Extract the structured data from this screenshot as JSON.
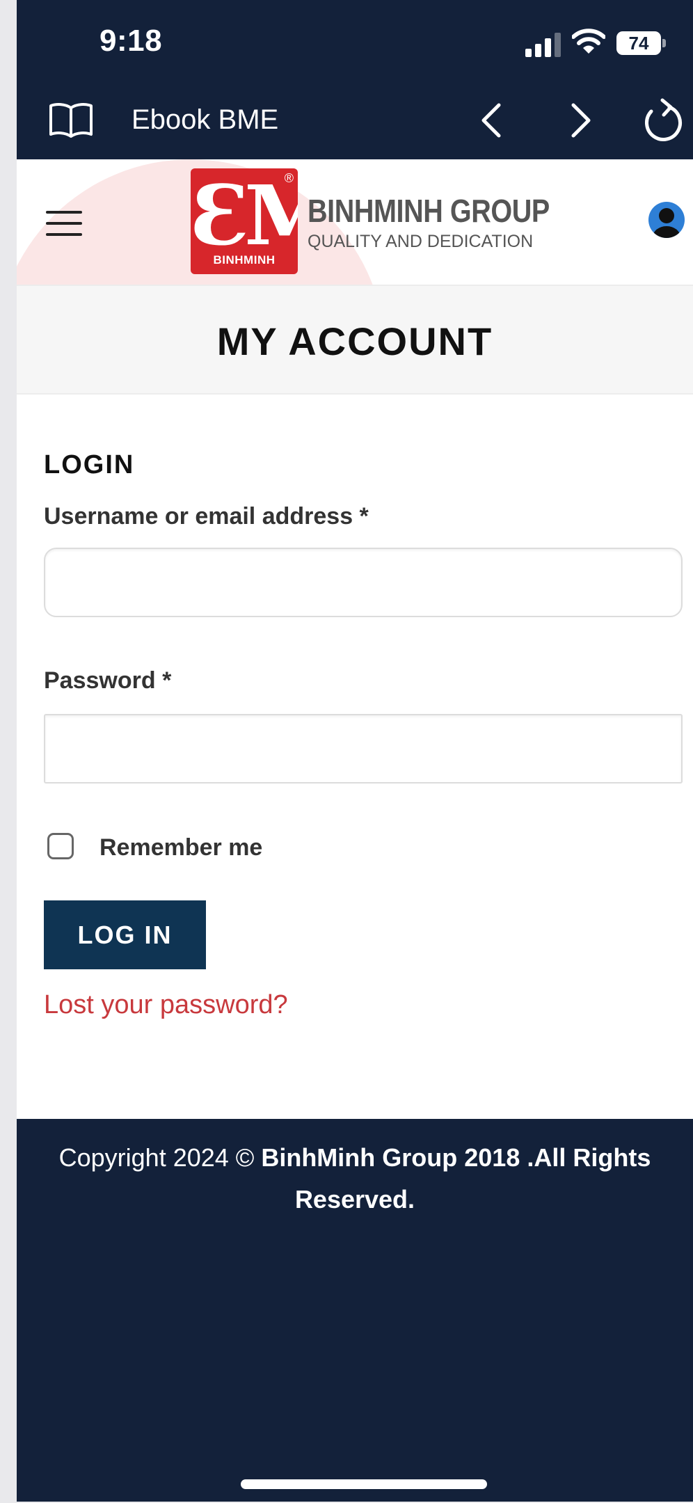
{
  "status_bar": {
    "time": "9:18",
    "battery": "74",
    "battery_level_percent": 74
  },
  "browser": {
    "title": "Ebook BME",
    "icons": [
      "book-icon",
      "back-icon",
      "forward-icon",
      "reload-icon"
    ]
  },
  "header": {
    "logo_mark": "ƐM",
    "logo_sub": "BINHMINH",
    "logo_reg": "®",
    "brand_name": "BINHMINH GROUP",
    "brand_tagline": "QUALITY AND DEDICATION",
    "icons": [
      "menu-icon",
      "user-icon"
    ],
    "accent_color": "#d7262b"
  },
  "page": {
    "title": "MY ACCOUNT"
  },
  "login": {
    "heading": "LOGIN",
    "username_label": "Username or email address *",
    "username_value": "",
    "password_label": "Password *",
    "password_value": "",
    "remember_label": "Remember me",
    "remember_checked": false,
    "submit_label": "LOG IN",
    "lost_password_link": "Lost your password?",
    "button_color": "#0f3453",
    "link_color": "#c8393d"
  },
  "footer": {
    "copyright_prefix": "Copyright 2024 © ",
    "copyright_bold": "BinhMinh Group 2018 .All Rights Reserved.",
    "background_color": "#13213a"
  }
}
